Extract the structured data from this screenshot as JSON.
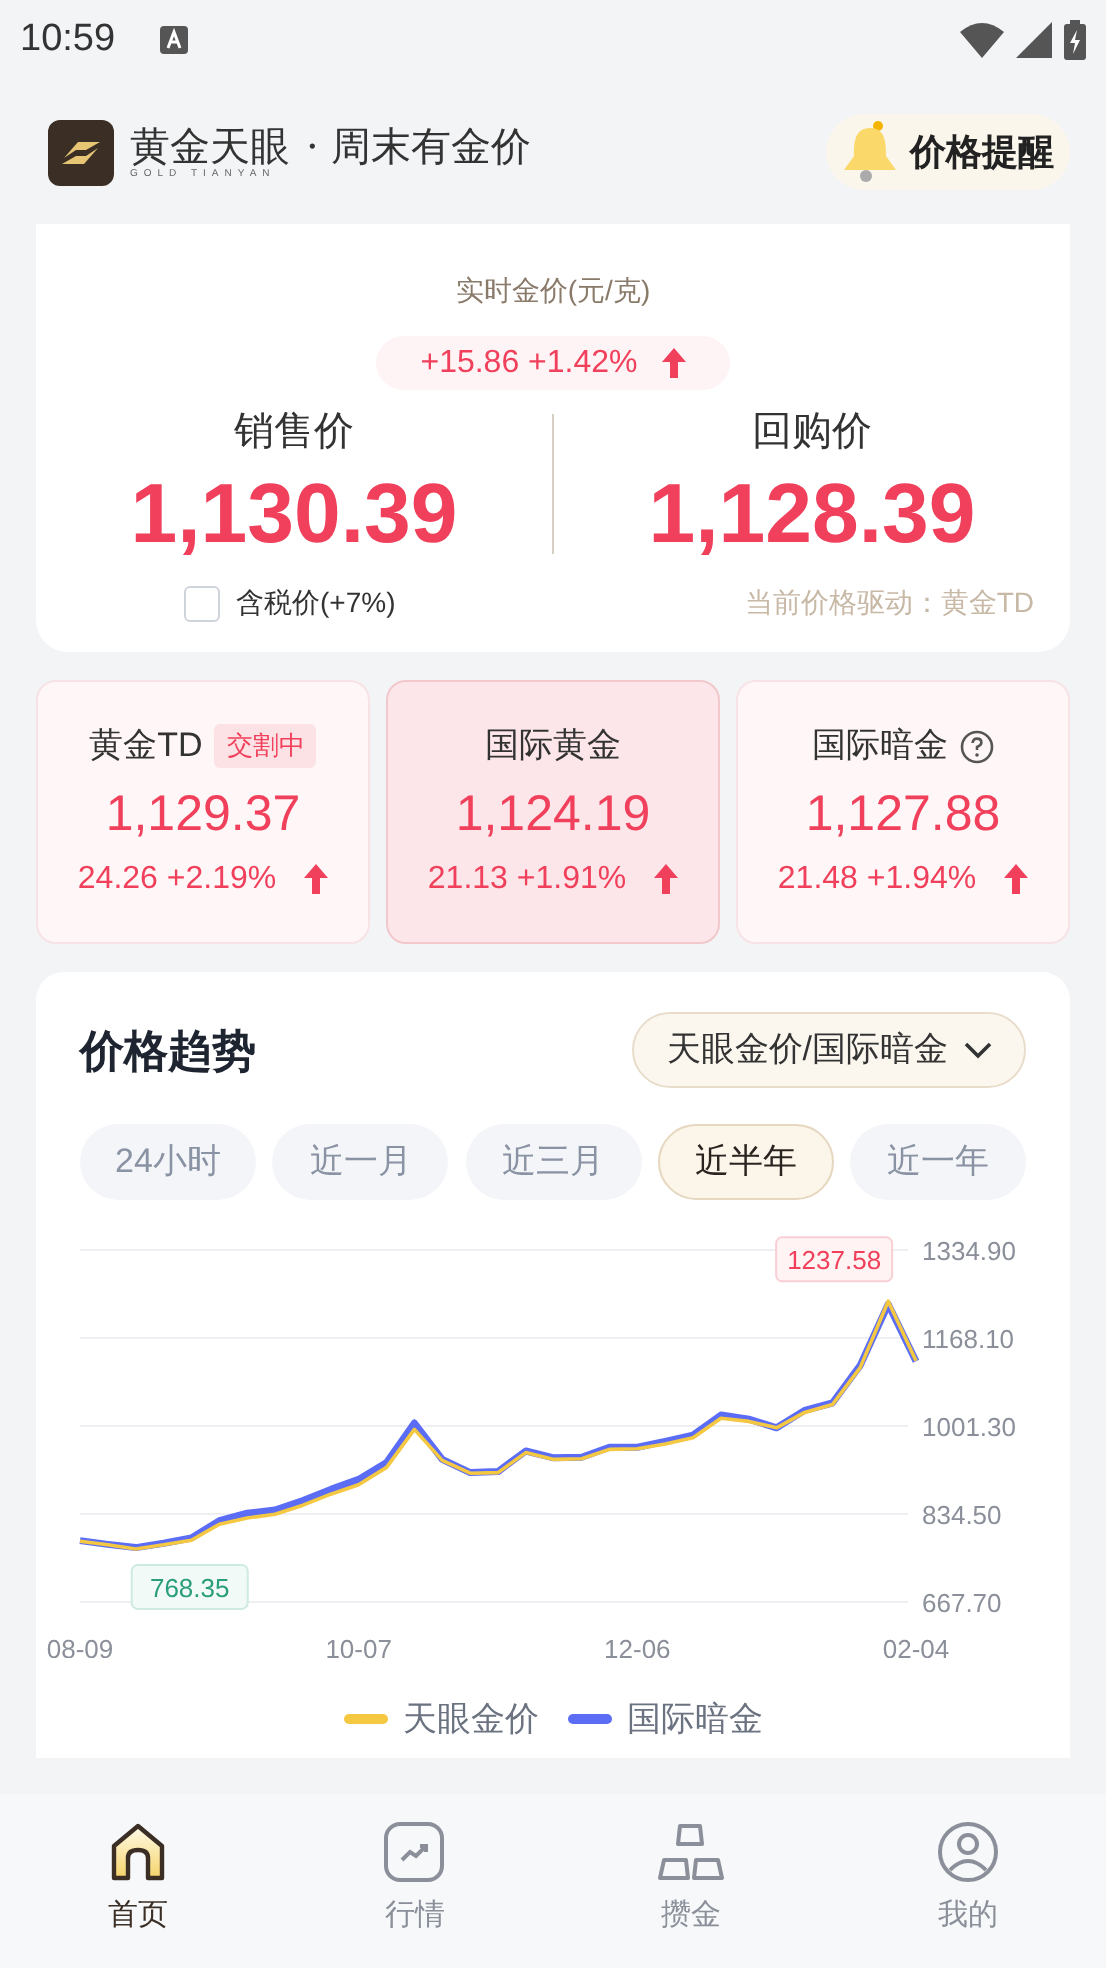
{
  "status_bar": {
    "time": "10:59"
  },
  "header": {
    "brand": "黄金天眼",
    "brand_sub": "GOLD TIANYAN",
    "slogan": "· 周末有金价",
    "alert_button": "价格提醒"
  },
  "price_card": {
    "subtitle": "实时金价(元/克)",
    "change": "+15.86 +1.42%",
    "up": true,
    "sell": {
      "label": "销售价",
      "price": "1,130.39"
    },
    "buy": {
      "label": "回购价",
      "price": "1,128.39"
    },
    "tax_checkbox": {
      "label": "含税价(+7%)",
      "checked": false
    },
    "driver": "当前价格驱动：黄金TD"
  },
  "markets": [
    {
      "name": "黄金TD",
      "badge": "交割中",
      "price": "1,129.37",
      "change": "24.26 +2.19%",
      "up": true,
      "selected": false,
      "help": false
    },
    {
      "name": "国际黄金",
      "price": "1,124.19",
      "change": "21.13 +1.91%",
      "up": true,
      "selected": true,
      "help": false
    },
    {
      "name": "国际暗金",
      "price": "1,127.88",
      "change": "21.48 +1.94%",
      "up": true,
      "selected": false,
      "help": true
    }
  ],
  "trend": {
    "title": "价格趋势",
    "source": "天眼金价/国际暗金",
    "ranges": [
      {
        "label": "24小时",
        "selected": false
      },
      {
        "label": "近一月",
        "selected": false
      },
      {
        "label": "近三月",
        "selected": false
      },
      {
        "label": "近半年",
        "selected": true
      },
      {
        "label": "近一年",
        "selected": false
      }
    ],
    "chart_data": {
      "type": "line",
      "categories": [
        "08-09",
        null,
        null,
        null,
        null,
        null,
        null,
        null,
        null,
        null,
        "10-07",
        null,
        null,
        null,
        null,
        null,
        null,
        null,
        null,
        null,
        "12-06",
        null,
        null,
        null,
        null,
        null,
        null,
        null,
        null,
        null,
        "02-04"
      ],
      "ylim": [
        667.7,
        1334.9
      ],
      "yticks": [
        {
          "value": 1334.9,
          "label": "1334.90"
        },
        {
          "value": 1168.1,
          "label": "1168.10"
        },
        {
          "value": 1001.3,
          "label": "1001.30"
        },
        {
          "value": 834.5,
          "label": "834.50"
        },
        {
          "value": 667.7,
          "label": "667.70"
        }
      ],
      "series": [
        {
          "name": "天眼金价",
          "color": "#f5c842",
          "values": [
            783,
            776,
            768,
            776,
            785,
            815,
            827,
            834,
            851,
            872,
            890,
            923,
            995,
            936,
            912,
            913,
            951,
            938,
            939,
            957,
            958,
            967,
            979,
            1016,
            1010,
            998,
            1027,
            1042,
            1112,
            1238,
            1125
          ]
        },
        {
          "name": "国际暗金",
          "color": "#5b6cf5",
          "values": [
            784,
            777,
            771,
            779,
            789,
            822,
            836,
            842,
            860,
            881,
            900,
            932,
            1007,
            938,
            913,
            915,
            954,
            941,
            942,
            961,
            961,
            972,
            984,
            1022,
            1014,
            998,
            1031,
            1045,
            1116,
            1232,
            1124
          ]
        }
      ],
      "grid": true,
      "annotations": [
        "1237.58",
        "768.35"
      ]
    }
  },
  "nav": [
    {
      "label": "首页",
      "kind": "home",
      "selected": true
    },
    {
      "label": "行情",
      "kind": "market",
      "selected": false
    },
    {
      "label": "攒金",
      "kind": "bars",
      "selected": false
    },
    {
      "label": "我的",
      "kind": "profile",
      "selected": false
    }
  ]
}
